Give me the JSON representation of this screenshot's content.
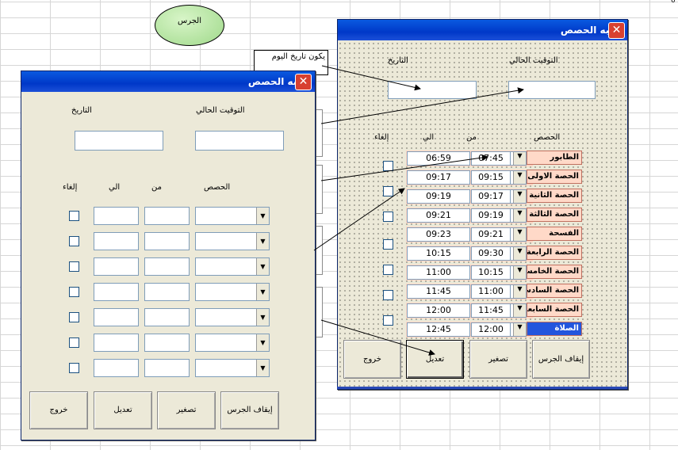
{
  "sheet": {
    "top_marker": "0",
    "shape_label": "الجرس",
    "note_label": "يكون تاريخ اليوم"
  },
  "left_form": {
    "title": "منبه الحصص",
    "date_label": "التاريخ",
    "time_label": "التوقيت الحالي",
    "col_periods": "الحصص",
    "col_from": "من",
    "col_to": "الي",
    "col_cancel": "إلغاء",
    "buttons": {
      "stop": "إيقاف الجرس",
      "minimize": "تصغير",
      "edit": "تعديل",
      "exit": "خروج"
    }
  },
  "right_form": {
    "title": "منبه الحصص",
    "date_label": "التاريخ",
    "time_label": "التوقيت الحالي",
    "col_periods": "الحصص",
    "col_from": "من",
    "col_to": "الي",
    "col_cancel": "إلغاء",
    "rows": [
      {
        "name": "الطابور",
        "from": "07:45",
        "to": "06:59"
      },
      {
        "name": "الحصة الاولى",
        "from": "09:15",
        "to": "09:17"
      },
      {
        "name": "الحصة الثانية",
        "from": "09:17",
        "to": "09:19"
      },
      {
        "name": "الحصة الثالثة",
        "from": "09:19",
        "to": "09:21"
      },
      {
        "name": "الفسحة",
        "from": "09:21",
        "to": "09:23"
      },
      {
        "name": "الحصة الرابعة",
        "from": "09:30",
        "to": "10:15"
      },
      {
        "name": "الحصة الخامسة",
        "from": "10:15",
        "to": "11:00"
      },
      {
        "name": "الحصة السادسة",
        "from": "11:00",
        "to": "11:45"
      },
      {
        "name": "الحصة السابعة",
        "from": "11:45",
        "to": "12:00"
      },
      {
        "name": "الصلاة",
        "from": "12:00",
        "to": "12:45"
      }
    ],
    "buttons": {
      "stop": "إيقاف الجرس",
      "minimize": "تصغير",
      "edit": "تعديل",
      "exit": "خروج"
    }
  }
}
